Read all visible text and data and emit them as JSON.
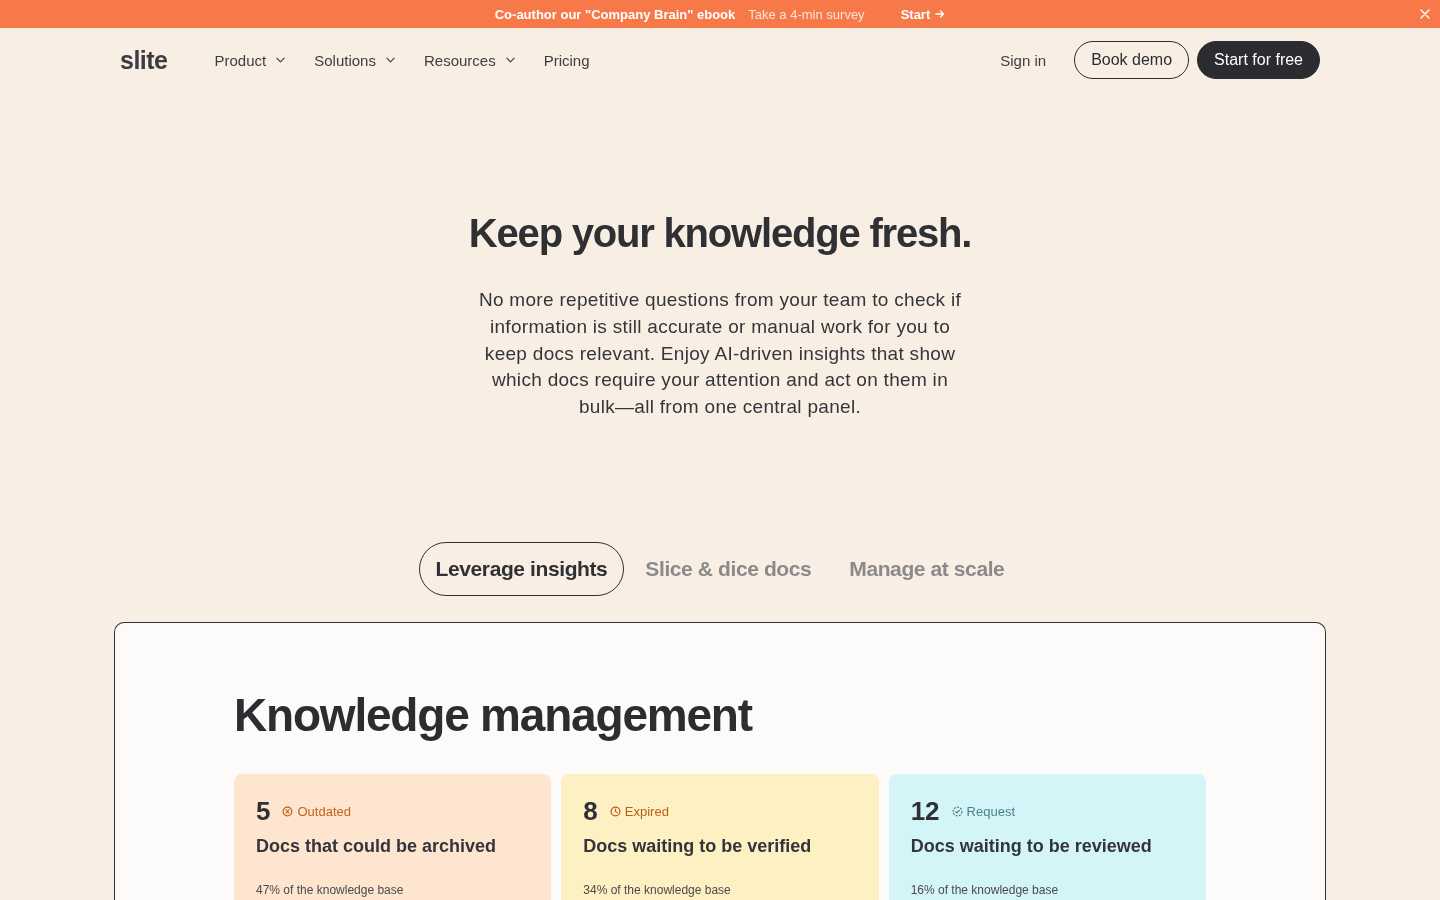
{
  "banner": {
    "title": "Co-author our \"Company Brain\" ebook",
    "subtitle": "Take a 4-min survey",
    "action": "Start"
  },
  "nav": {
    "logo": "slite",
    "items": [
      {
        "label": "Product",
        "has_menu": true
      },
      {
        "label": "Solutions",
        "has_menu": true
      },
      {
        "label": "Resources",
        "has_menu": true
      },
      {
        "label": "Pricing",
        "has_menu": false
      }
    ],
    "sign_in": "Sign in",
    "buttons": [
      {
        "label": "Book demo",
        "kind": "outline"
      },
      {
        "label": "Start for free",
        "kind": "solid"
      }
    ]
  },
  "hero": {
    "title": "Keep your knowledge fresh.",
    "text": "No more repetitive questions from your team to check if information is still accurate or manual work for you to keep docs relevant. Enjoy AI-driven insights that show which docs require your attention and act on them in bulk—all from one central panel."
  },
  "tabs": [
    {
      "label": "Leverage insights",
      "selected": true
    },
    {
      "label": "Slice & dice docs",
      "selected": false
    },
    {
      "label": "Manage at scale",
      "selected": false
    }
  ],
  "panel": {
    "title": "Knowledge management",
    "cards": [
      {
        "count": "5",
        "status": "Outdated",
        "kind": "outdated",
        "color": "#fde5cf",
        "title": "Docs that could be archived",
        "share": "47% of the knowledge base"
      },
      {
        "count": "8",
        "status": "Expired",
        "kind": "expired",
        "color": "#fdf0c2",
        "title": "Docs waiting to be verified",
        "share": "34% of the knowledge base"
      },
      {
        "count": "12",
        "status": "Request",
        "kind": "request",
        "color": "#d4f5f7",
        "title": "Docs waiting to be reviewed",
        "share": "16% of the knowledge base"
      }
    ]
  }
}
